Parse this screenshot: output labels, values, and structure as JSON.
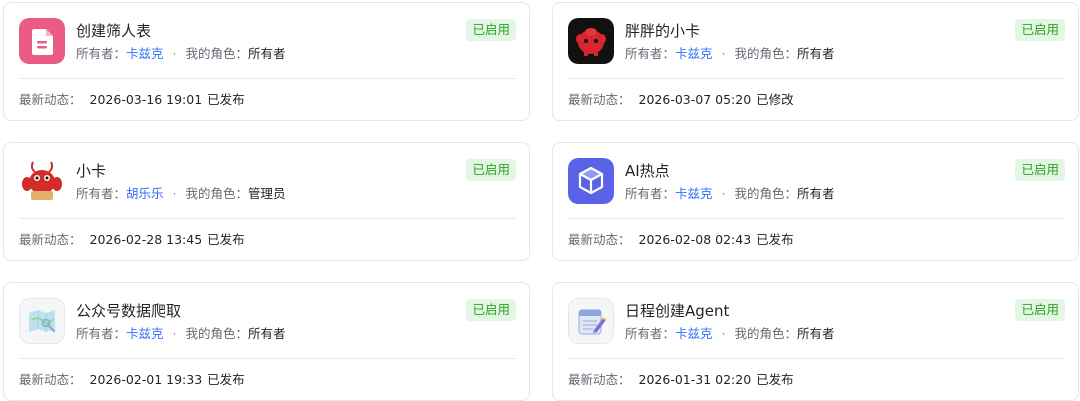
{
  "labels": {
    "owner_prefix": "所有者：",
    "role_prefix": "我的角色：",
    "activity_prefix": "最新动态：",
    "separator": "·"
  },
  "cards": [
    {
      "title": "创建筛人表",
      "owner": "卡兹克",
      "role": "所有者",
      "status": "已启用",
      "timestamp": "2026-03-16 19:01",
      "action": "已发布",
      "icon": "pink-document-icon"
    },
    {
      "title": "胖胖的小卡",
      "owner": "卡兹克",
      "role": "所有者",
      "status": "已启用",
      "timestamp": "2026-03-07 05:20",
      "action": "已修改",
      "icon": "red-creature-avatar"
    },
    {
      "title": "小卡",
      "owner": "胡乐乐",
      "role": "管理员",
      "status": "已启用",
      "timestamp": "2026-02-28 13:45",
      "action": "已发布",
      "icon": "red-lobster-avatar"
    },
    {
      "title": "AI热点",
      "owner": "卡兹克",
      "role": "所有者",
      "status": "已启用",
      "timestamp": "2026-02-08 02:43",
      "action": "已发布",
      "icon": "purple-cube-icon"
    },
    {
      "title": "公众号数据爬取",
      "owner": "卡兹克",
      "role": "所有者",
      "status": "已启用",
      "timestamp": "2026-02-01 19:33",
      "action": "已发布",
      "icon": "map-icon"
    },
    {
      "title": "日程创建Agent",
      "owner": "卡兹克",
      "role": "所有者",
      "status": "已启用",
      "timestamp": "2026-01-31 02:20",
      "action": "已发布",
      "icon": "calendar-icon"
    }
  ]
}
